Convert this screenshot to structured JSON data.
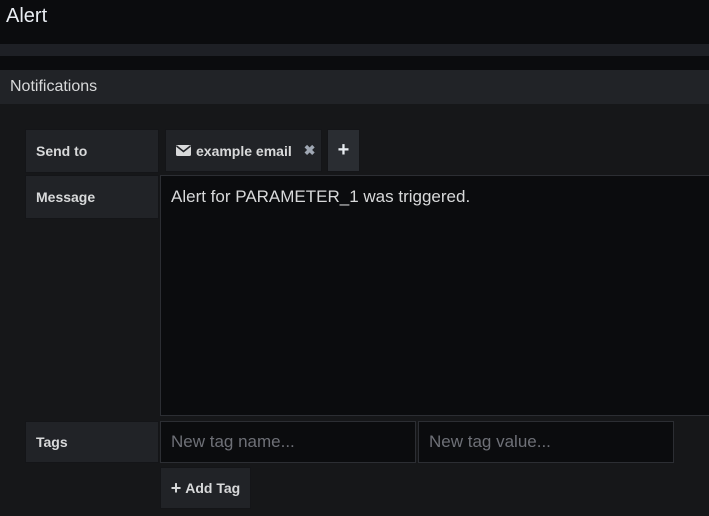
{
  "header": {
    "title": "Alert"
  },
  "notifications": {
    "section_title": "Notifications",
    "send_to": {
      "label": "Send to",
      "recipient": "example email",
      "recipient_icon": "envelope-icon",
      "remove_glyph": "✖",
      "add_glyph": "+"
    },
    "message": {
      "label": "Message",
      "value": "Alert for PARAMETER_1 was triggered."
    },
    "tags": {
      "label": "Tags",
      "name_placeholder": "New tag name...",
      "value_placeholder": "New tag value...",
      "add_label": "Add Tag",
      "add_glyph": "+"
    }
  }
}
